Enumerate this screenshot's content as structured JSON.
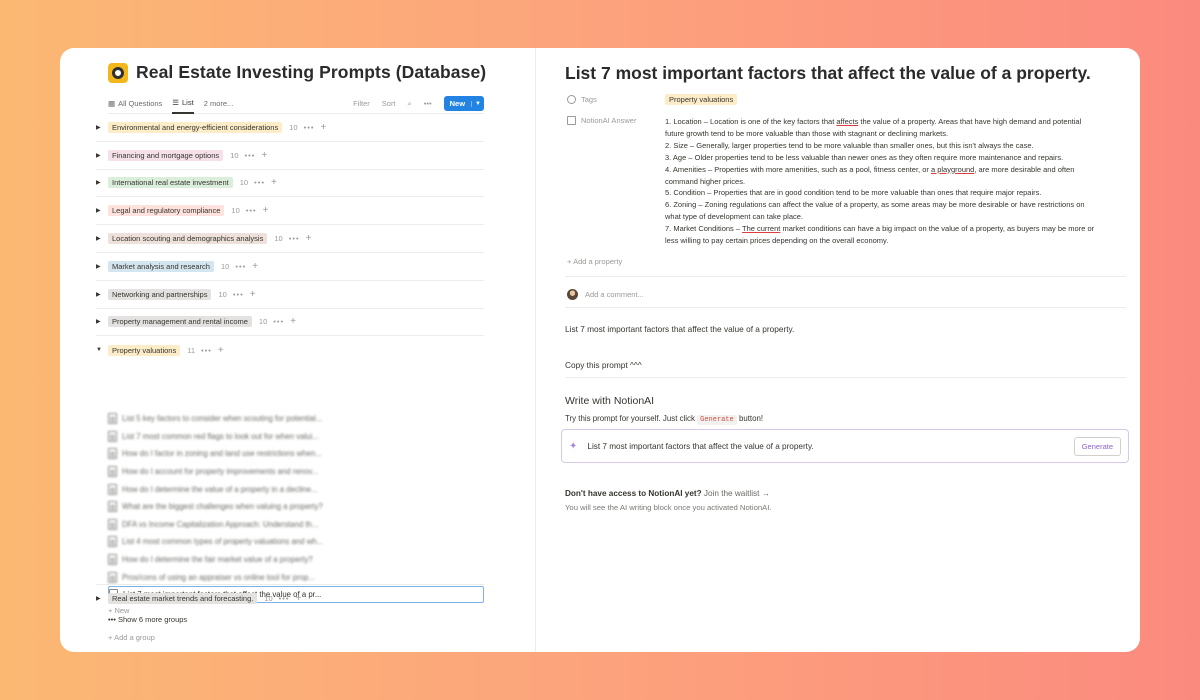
{
  "database": {
    "title": "Real Estate Investing Prompts (Database)",
    "views": [
      {
        "label": "All Questions",
        "icon": "table-icon"
      },
      {
        "label": "List",
        "icon": "list-icon"
      },
      {
        "label": "2 more...",
        "icon": ""
      }
    ],
    "tools": {
      "filter": "Filter",
      "sort": "Sort",
      "new": "New"
    },
    "groups": [
      {
        "label": "Environmental and energy-efficient considerations",
        "count": "10",
        "color": "#fdecc8"
      },
      {
        "label": "Financing and mortgage options",
        "count": "10",
        "color": "#f5e0e9"
      },
      {
        "label": "International real estate investment",
        "count": "10",
        "color": "#dbeddb"
      },
      {
        "label": "Legal and regulatory compliance",
        "count": "10",
        "color": "#ffe2dd"
      },
      {
        "label": "Location scouting and demographics analysis",
        "count": "10",
        "color": "#eee0da"
      },
      {
        "label": "Market analysis and research",
        "count": "10",
        "color": "#d3e5ef"
      },
      {
        "label": "Networking and partnerships",
        "count": "10",
        "color": "#e3e2e0"
      },
      {
        "label": "Property management and rental income",
        "count": "10",
        "color": "#e3e2e0"
      },
      {
        "label": "Property valuations",
        "count": "11",
        "color": "#fdecc8",
        "expanded": true
      }
    ],
    "items": [
      "List 5 key factors to consider when scouting for potential...",
      "List 7 most common red flags to look out for when valui...",
      "How do I factor in zoning and land use restrictions when...",
      "How do I account for property improvements and renov...",
      "How do I determine the value of a property in a decline...",
      "What are the biggest challenges when valuing a property?",
      "DFA vs Income Capitalization Approach: Understand th...",
      "List 4 most common types of property valuations and wh...",
      "How do I determine the fair market value of a property?",
      "Pros/cons of using an appraiser vs online tool for prop...",
      "List 7 most important factors that affect the value of a pr..."
    ],
    "new_label": "New",
    "bottom_group": {
      "label": "Real estate market trends and forecasting.",
      "count": "10",
      "color": "#e3e2e0"
    },
    "show_more": "Show 6 more groups",
    "add_group": "Add a group"
  },
  "page": {
    "title": "List 7 most important factors that affect the value of a property.",
    "tags_label": "Tags",
    "tag_value": "Property valuations",
    "answer_label": "NotionAI Answer",
    "add_property": "Add a property",
    "comment_placeholder": "Add a comment...",
    "prompt_text": "List 7 most important factors that affect the value of a property.",
    "copy_prompt": "Copy this prompt ^^^",
    "write_heading": "Write with NotionAI",
    "try_text": "Try this prompt for yourself. Just click",
    "try_code": "Generate",
    "try_suffix": "button!",
    "gen_prompt": "List 7 most important factors that affect the value of a property.",
    "gen_button": "Generate",
    "waitlist_bold": "Don't have access to NotionAI yet?",
    "waitlist_link": "Join the waitlist →",
    "waitlist_sub": "You will see the AI writing block once you activated NotionAI."
  }
}
